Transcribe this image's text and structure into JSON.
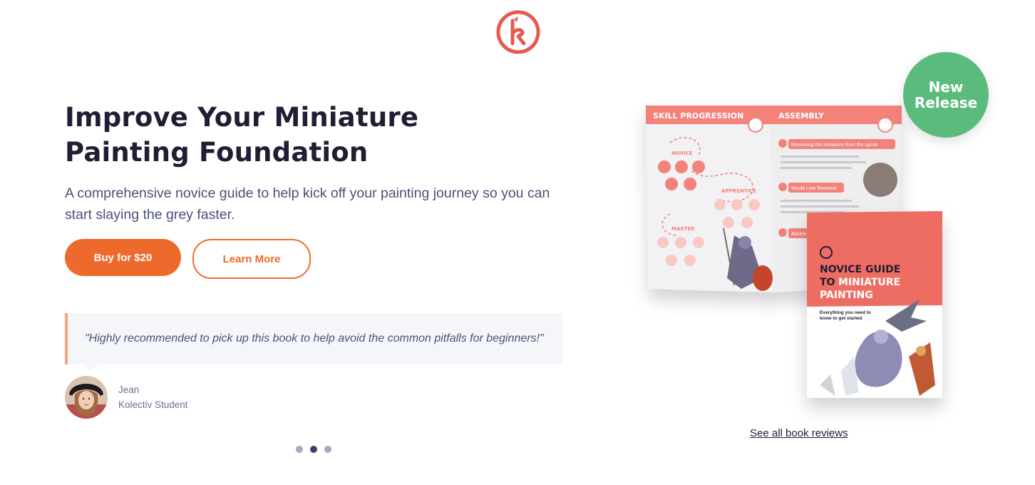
{
  "brand": {
    "logo_icon": "kolectiv-logo-icon",
    "accent": "#ee6a2c",
    "logo_color": "#e8584f"
  },
  "hero": {
    "title_line1": "Improve Your Miniature",
    "title_line2": "Painting Foundation",
    "subtitle": "A comprehensive novice guide to help kick off your painting journey so you can start slaying the grey faster."
  },
  "buttons": {
    "buy_label": "Buy for $20",
    "learn_label": "Learn More"
  },
  "testimonial": {
    "quote": "\"Highly recommended to pick up this book to help avoid the common pitfalls for beginners!\"",
    "author_name": "Jean",
    "author_role": "Kolectiv Student"
  },
  "carousel": {
    "count": 3,
    "active_index": 1
  },
  "badge": {
    "line1": "New",
    "line2": "Release",
    "color": "#5bbb7c"
  },
  "book": {
    "left_page_heading": "SKILL PROGRESSION",
    "right_page_heading": "ASSEMBLY",
    "level_novice": "NOVICE",
    "level_apprentice": "APPRENTICE",
    "level_master": "MASTER",
    "step1": "Removing the miniature from the sprue",
    "step2": "Mould Line Removal",
    "step3": "Assem",
    "cover_title_line1": "NOVICE GUIDE",
    "cover_title_to": "TO",
    "cover_title_highlight1": "MINIATURE",
    "cover_title_line3": "PAINTING",
    "cover_subtitle_line1": "Everything you need to",
    "cover_subtitle_line2": "know to get started"
  },
  "links": {
    "reviews": "See all book reviews"
  }
}
